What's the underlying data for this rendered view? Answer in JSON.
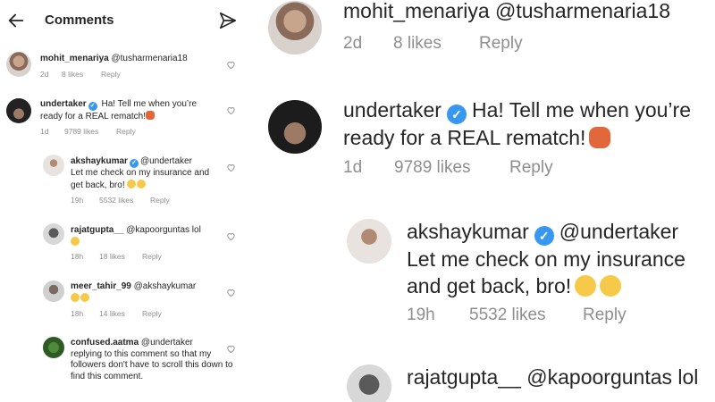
{
  "header": {
    "title": "Comments"
  },
  "comments": [
    {
      "user": "mohit_menariya",
      "mention": "@tusharmenaria18",
      "text": "",
      "time": "2d",
      "likes": "8 likes",
      "reply": "Reply"
    },
    {
      "user": "undertaker",
      "verified": true,
      "text": "Ha! Tell me when you’re ready for a REAL rematch!",
      "time": "1d",
      "likes": "9789 likes",
      "reply": "Reply"
    },
    {
      "user": "akshaykumar",
      "verified": true,
      "mention": "@undertaker",
      "text": "Let me check on my insurance and get back, bro!",
      "time": "19h",
      "likes": "5532 likes",
      "reply": "Reply"
    },
    {
      "user": "rajatgupta__",
      "mention": "@kapoorguntas",
      "text": "lol",
      "time": "18h",
      "likes": "18 likes",
      "reply": "Reply"
    },
    {
      "user": "meer_tahir_99",
      "mention": "@akshaykumar",
      "text": "",
      "time": "18h",
      "likes": "14 likes",
      "reply": "Reply"
    },
    {
      "user": "confused.aatma",
      "mention": "@undertaker",
      "text": "replying to this comment so that my followers don't have to scroll this down to find this comment.",
      "time": "",
      "likes": "",
      "reply": ""
    }
  ],
  "colors": {
    "verified": "#3897f0",
    "text": "#262626",
    "muted": "#8e8e8e"
  },
  "icons": [
    "back-arrow-icon",
    "send-icon",
    "heart-icon",
    "verified-badge-icon"
  ]
}
